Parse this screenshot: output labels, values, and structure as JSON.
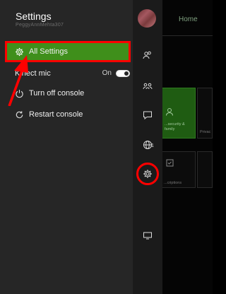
{
  "guide": {
    "title": "Settings",
    "gamertag": "PeggyAnnMehta307",
    "items": {
      "all_settings": "All Settings",
      "kinect_mic": "Kinect mic",
      "kinect_state": "On",
      "turn_off": "Turn off console",
      "restart": "Restart console"
    }
  },
  "rail": {
    "globe_count": "1"
  },
  "home": {
    "tab": "Home",
    "tile_network_text": "...security &\nfamily",
    "tile_privacy_text": "Privac",
    "tile_sub_text": "...criptions"
  },
  "colors": {
    "accent": "#3f8f1b",
    "highlight": "#ff0000",
    "panel": "#262626"
  },
  "icons": [
    "gear-icon",
    "power-icon",
    "restart-icon",
    "friends-icon",
    "party-icon",
    "chat-icon",
    "globe-icon",
    "settings-icon",
    "tv-icon",
    "person-icon",
    "checklist-icon"
  ]
}
